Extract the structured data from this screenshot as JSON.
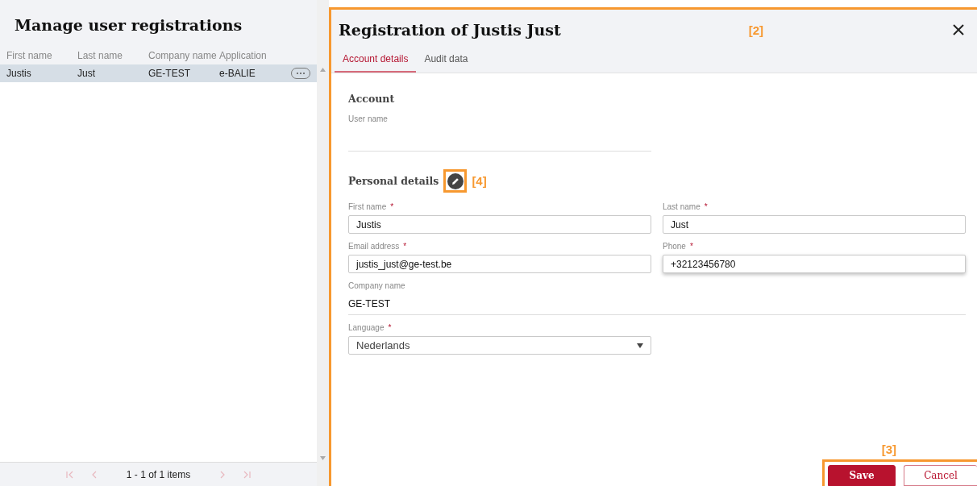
{
  "list_panel": {
    "title": "Manage user registrations",
    "columns": [
      "First name",
      "Last name",
      "Company name",
      "Application"
    ],
    "rows": [
      {
        "cells": [
          "Justis",
          "Just",
          "GE-TEST",
          "e-BALIE"
        ],
        "selected": true
      }
    ],
    "pager": {
      "summary": "1 - 1 of 1 items"
    }
  },
  "dialog": {
    "title": "Registration of Justis Just",
    "callout": "[2]",
    "tabs": [
      {
        "label": "Account details",
        "selected": true
      },
      {
        "label": "Audit data",
        "selected": false
      }
    ],
    "sections": [
      {
        "title": "Account",
        "fields": [
          {
            "kind": "underline",
            "label": "User name"
          }
        ]
      },
      {
        "title": "Personal details",
        "edit_callout": "[4]",
        "fields": [
          {
            "kind": "input",
            "label": "First name",
            "required_mark": "*",
            "value": "Justis"
          },
          {
            "kind": "input",
            "label": "Last name",
            "required_mark": "*",
            "value": "Just"
          },
          {
            "kind": "input",
            "label": "Email address",
            "required_mark": "*",
            "value": "justis_just@ge-test.be"
          },
          {
            "kind": "input",
            "label": "Phone",
            "required_mark": "*",
            "value": "+32123456780",
            "focused": true
          },
          {
            "kind": "display",
            "label": "Company name",
            "value": "GE-TEST"
          },
          {
            "kind": "select",
            "label": "Language",
            "required_mark": "*",
            "value": "Nederlands"
          }
        ]
      }
    ],
    "footer_callout": "[3]",
    "buttons": [
      {
        "label": "Save",
        "kind": "primary"
      },
      {
        "label": "Cancel",
        "kind": "secondary"
      }
    ]
  }
}
